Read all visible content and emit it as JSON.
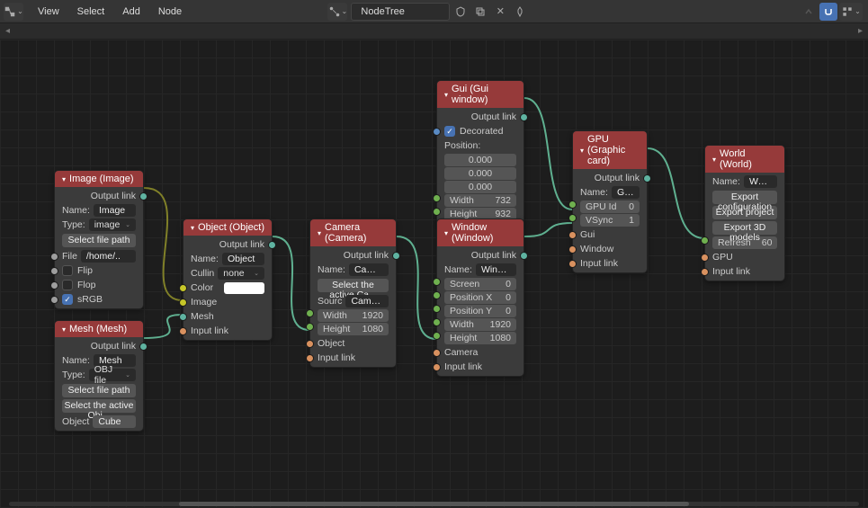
{
  "header": {
    "menu": [
      "View",
      "Select",
      "Add",
      "Node"
    ],
    "tree_name": "NodeTree"
  },
  "nodes": {
    "image": {
      "title": "Image (Image)",
      "output": "Output link",
      "name_label": "Name:",
      "name": "Image",
      "type_label": "Type:",
      "type": "image",
      "select_file": "Select file path",
      "file_label": "File",
      "file": "/home/..",
      "flip": "Flip",
      "flop": "Flop",
      "srgb": "sRGB"
    },
    "mesh": {
      "title": "Mesh (Mesh)",
      "output": "Output link",
      "name_label": "Name:",
      "name": "Mesh",
      "type_label": "Type:",
      "type": "OBJ file",
      "select_file": "Select file path",
      "select_obj": "Select the active Obj...",
      "object_label": "Object",
      "object": "Cube"
    },
    "object": {
      "title": "Object (Object)",
      "output": "Output link",
      "name_label": "Name:",
      "name": "Object",
      "culling_label": "Cullin",
      "culling": "none",
      "color": "Color",
      "image": "Image",
      "mesh": "Mesh",
      "input": "Input link"
    },
    "camera": {
      "title": "Camera (Camera)",
      "output": "Output link",
      "name_label": "Name:",
      "name": "Camera",
      "select": "Select the active Ca...",
      "source_label": "Sourc",
      "source": "Camera",
      "width_label": "Width",
      "width": "1920",
      "height_label": "Height",
      "height": "1080",
      "object": "Object",
      "input": "Input link"
    },
    "gui": {
      "title": "Gui (Gui window)",
      "output": "Output link",
      "decorated": "Decorated",
      "position": "Position:",
      "p0": "0.000",
      "p1": "0.000",
      "p2": "0.000",
      "width_label": "Width",
      "width": "732",
      "height_label": "Height",
      "height": "932"
    },
    "window": {
      "title": "Window (Window)",
      "output": "Output link",
      "name_label": "Name:",
      "name": "Window",
      "screen_label": "Screen",
      "screen": "0",
      "px_label": "Position X",
      "px": "0",
      "py_label": "Position Y",
      "py": "0",
      "width_label": "Width",
      "width": "1920",
      "height_label": "Height",
      "height": "1080",
      "camera": "Camera",
      "input": "Input link"
    },
    "gpu": {
      "title": "GPU (Graphic card)",
      "output": "Output link",
      "name_label": "Name:",
      "name": "GPU",
      "gpuid_label": "GPU Id",
      "gpuid": "0",
      "vsync_label": "VSync",
      "vsync": "1",
      "gui": "Gui",
      "window": "Window",
      "input": "Input link"
    },
    "world": {
      "title": "World (World)",
      "name_label": "Name:",
      "name": "World",
      "b1": "Export configuration",
      "b2": "Export project",
      "b3": "Export 3D models",
      "refresh_label": "Refresh rate",
      "refresh": "60",
      "gpu": "GPU",
      "input": "Input link"
    }
  }
}
